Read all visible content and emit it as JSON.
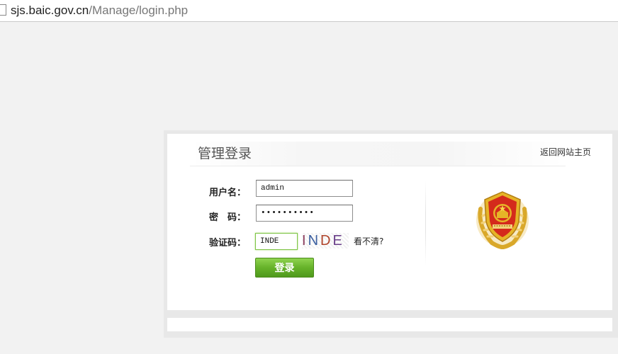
{
  "browser": {
    "url_host": "sjs.baic.gov.cn",
    "url_path": "/Manage/login.php"
  },
  "login": {
    "title": "管理登录",
    "back_link": "返回网站主页",
    "username_label": "用户名：",
    "username_value": "admin",
    "password_label": "密　码：",
    "password_value": "••••••••••",
    "captcha_label": "验证码：",
    "captcha_value": "INDE",
    "captcha_image_text": [
      "I",
      "N",
      "D",
      "E"
    ],
    "captcha_colors": [
      "#8a3b5c",
      "#3b5fa0",
      "#b0452c",
      "#6a3f8a"
    ],
    "refresh_link": "看不清?",
    "submit_label": "登录"
  },
  "emblem": {
    "name": "emblem-icon",
    "colors": {
      "red": "#d42a1c",
      "gold": "#e6b427"
    }
  },
  "colors": {
    "button_green": "#66b22a",
    "page_background": "#f2f2f2"
  }
}
